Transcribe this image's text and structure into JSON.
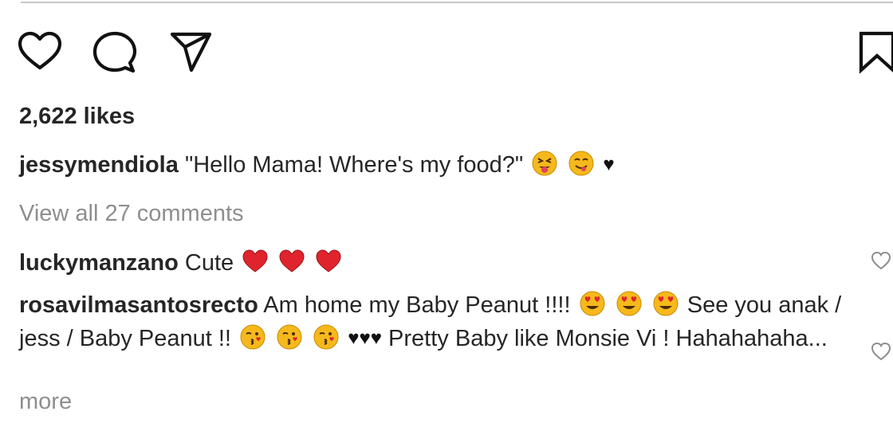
{
  "post": {
    "likes": "2,622 likes",
    "caption": {
      "user": "jessymendiola",
      "text": "\"Hello Mama! Where's my food?\""
    },
    "view_all": "View all 27 comments",
    "comments": [
      {
        "user": "luckymanzano",
        "text": "Cute"
      },
      {
        "user": "rosavilmasantosrecto",
        "text_a": "Am home my Baby Peanut !!!!",
        "text_b": "See you anak / jess / Baby Peanut !!",
        "text_c": "Pretty Baby like Monsie Vi ! Hahahahaha..."
      }
    ],
    "more": "more"
  },
  "icons": {
    "like": "heart-outline-icon",
    "comment": "speech-bubble-icon",
    "share": "paper-plane-icon",
    "save": "bookmark-icon"
  },
  "colors": {
    "text": "#262626",
    "muted": "#8e8e8e",
    "heart_red": "#e0242e",
    "emoji_yellow": "#f6b91c"
  }
}
